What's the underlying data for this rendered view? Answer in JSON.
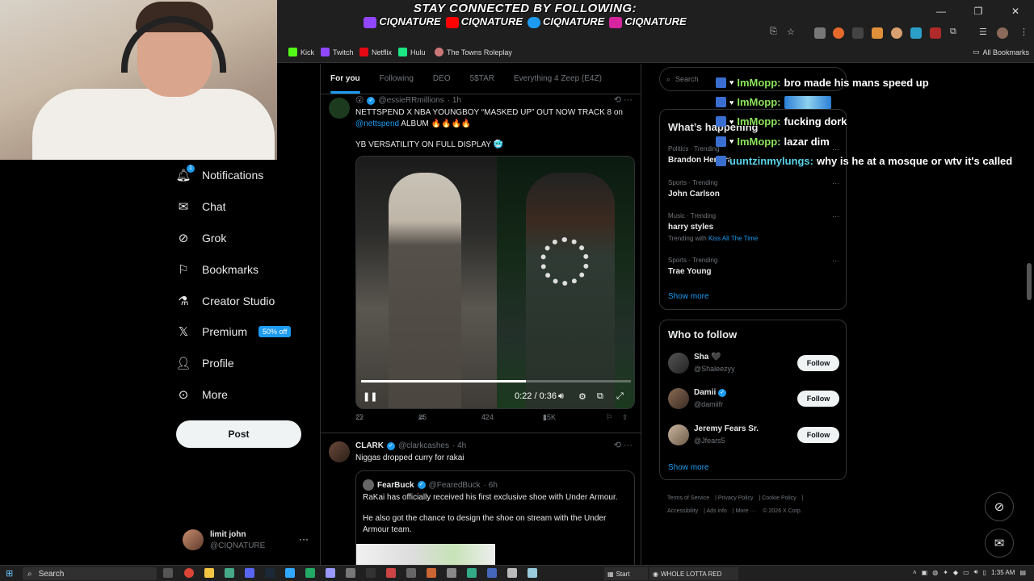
{
  "overlay": {
    "banner_line1": "STAY CONNECTED BY FOLLOWING:",
    "banner_handle_twitch": "CIQNATURE",
    "banner_handle_youtube": "CIQNATURE",
    "banner_handle_twitter": "CIQNATURE",
    "banner_handle_instagram": "CIQNATURE"
  },
  "bookmarks": [
    {
      "label": "Kick"
    },
    {
      "label": "Twitch"
    },
    {
      "label": "Netflix"
    },
    {
      "label": "Hulu"
    },
    {
      "label": "The Towns Roleplay"
    }
  ],
  "bookmarks_all": "All Bookmarks",
  "nav": {
    "notifications": "Notifications",
    "notifications_badge": "1",
    "chat": "Chat",
    "grok": "Grok",
    "bookmarks": "Bookmarks",
    "creator_studio": "Creator Studio",
    "premium": "Premium",
    "premium_badge": "50% off",
    "profile": "Profile",
    "more": "More",
    "post": "Post"
  },
  "account": {
    "name": "limit john",
    "handle": "@CIQNATURE"
  },
  "tabs": [
    "For you",
    "Following",
    "DEO",
    "5$TAR",
    "Everything 4 Zeep (E4Z)"
  ],
  "tweet1": {
    "handle": "@essieRRmillions",
    "time": "· 1h",
    "text1": "NETTSPEND X NBA YOUNGBOY “MASKED UP” OUT NOW TRACK 8 on",
    "mention": "@nettspend",
    "text1b": " ALBUM 🔥🔥🔥🔥",
    "text2": "YB VERSATILITY ON FULL DISPLAY 🥶",
    "video_time": "0:22 / 0:36",
    "video_progress": 0.61,
    "replies": "22",
    "reposts": "25",
    "likes": "424",
    "views": "15K"
  },
  "tweet2": {
    "name": "CLARK",
    "handle": "@clarkcashes",
    "time": "· 4h",
    "text": "Niggas dropped curry for rakai",
    "quote_name": "FearBuck",
    "quote_handle": "@FearedBuck",
    "quote_time": "· 6h",
    "quote_text1": "RaKai has officially received his first exclusive shoe with Under Armour.",
    "quote_text2": "He also got the chance to design the shoe on stream with the Under Armour team."
  },
  "search_placeholder": "Search",
  "trends": {
    "title": "What’s happening",
    "items": [
      {
        "category": "Politics · Trending",
        "title": "Brandon Herrera",
        "sub": "",
        "sub_link": ""
      },
      {
        "category": "Sports · Trending",
        "title": "John Carlson",
        "sub": "",
        "sub_link": ""
      },
      {
        "category": "Music · Trending",
        "title": "harry styles",
        "sub": "Trending with ",
        "sub_link": "Kiss All The Time"
      },
      {
        "category": "Sports · Trending",
        "title": "Trae Young",
        "sub": "",
        "sub_link": ""
      }
    ],
    "show_more": "Show more"
  },
  "who_to_follow": {
    "title": "Who to follow",
    "items": [
      {
        "name": "Sha 🖤",
        "handle": "@Shaleezyy",
        "button": "Follow"
      },
      {
        "name": "Damii",
        "handle": "@damiifr",
        "button": "Follow"
      },
      {
        "name": "Jeremy Fears Sr.",
        "handle": "@Jfears5",
        "button": "Follow"
      }
    ],
    "show_more": "Show more"
  },
  "footer": {
    "terms": "Terms of Service",
    "privacy": "Privacy Policy",
    "cookie": "Cookie Policy",
    "accessibility": "Accessibility",
    "ads": "Ads info",
    "more": "More ···",
    "copyright": "© 2026 X Corp."
  },
  "chat": [
    {
      "user": "ImMopp:",
      "message": "bro made his mans speed up"
    },
    {
      "user": "ImMopp:",
      "message": ""
    },
    {
      "user": "ImMopp:",
      "message": "fucking dork"
    },
    {
      "user": "ImMopp:",
      "message": "lazar dim"
    },
    {
      "user": "uuntzinmylungs:",
      "message": "why is he at a mosque or wtv it's called"
    }
  ],
  "taskbar": {
    "search": "Search",
    "start_label": "Start",
    "media_title": "WHOLE LOTTA RED",
    "time": "1:35 AM"
  },
  "colors": {
    "accent": "#1d9bf0",
    "background": "#000000",
    "chat_user": "#8ce35a"
  }
}
